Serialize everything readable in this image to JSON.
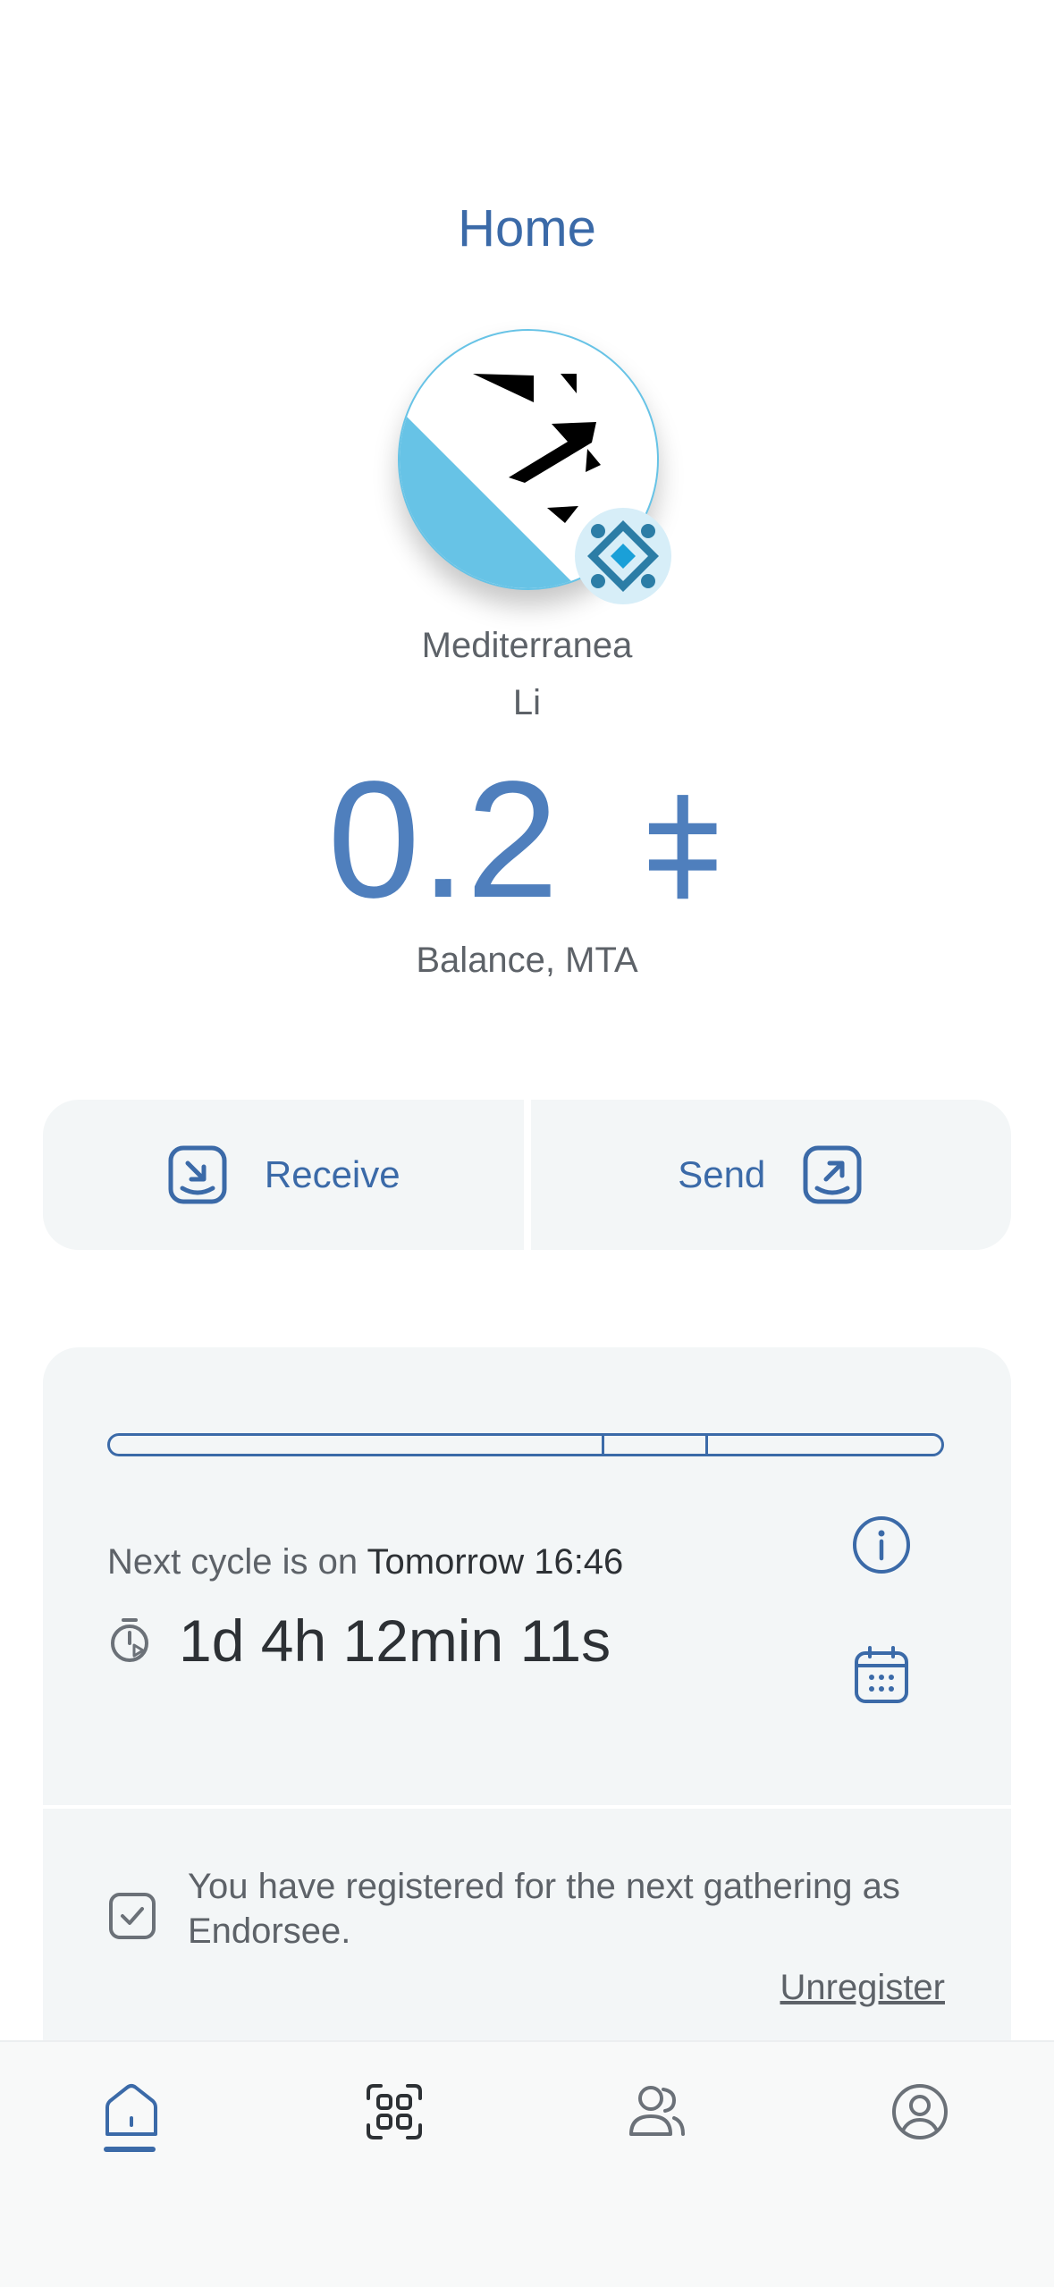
{
  "header": {
    "title": "Home"
  },
  "profile": {
    "name_line1": "Mediterranea",
    "name_line2": "Li",
    "avatar_colors": {
      "primary": "#67c3e6",
      "badge": "#2c7da6"
    }
  },
  "balance": {
    "amount": "0.2",
    "symbol": "⧧",
    "label": "Balance, MTA"
  },
  "actions": {
    "receive_label": "Receive",
    "send_label": "Send"
  },
  "cycle": {
    "prefix": "Next cycle is on",
    "date": "Tomorrow 16:46",
    "countdown": "1d 4h 12min 11s"
  },
  "registration": {
    "message": "You have registered for the next gathering as Endorsee.",
    "unregister_label": "Unregister"
  },
  "tabbar": {
    "items": [
      {
        "icon": "home-icon",
        "active": true
      },
      {
        "icon": "qr-code-icon",
        "active": false
      },
      {
        "icon": "contacts-icon",
        "active": false
      },
      {
        "icon": "profile-icon",
        "active": false
      }
    ]
  },
  "colors": {
    "accent": "#3b6aa8",
    "balance": "#4f7fbd",
    "card_bg": "#f3f6f7"
  }
}
